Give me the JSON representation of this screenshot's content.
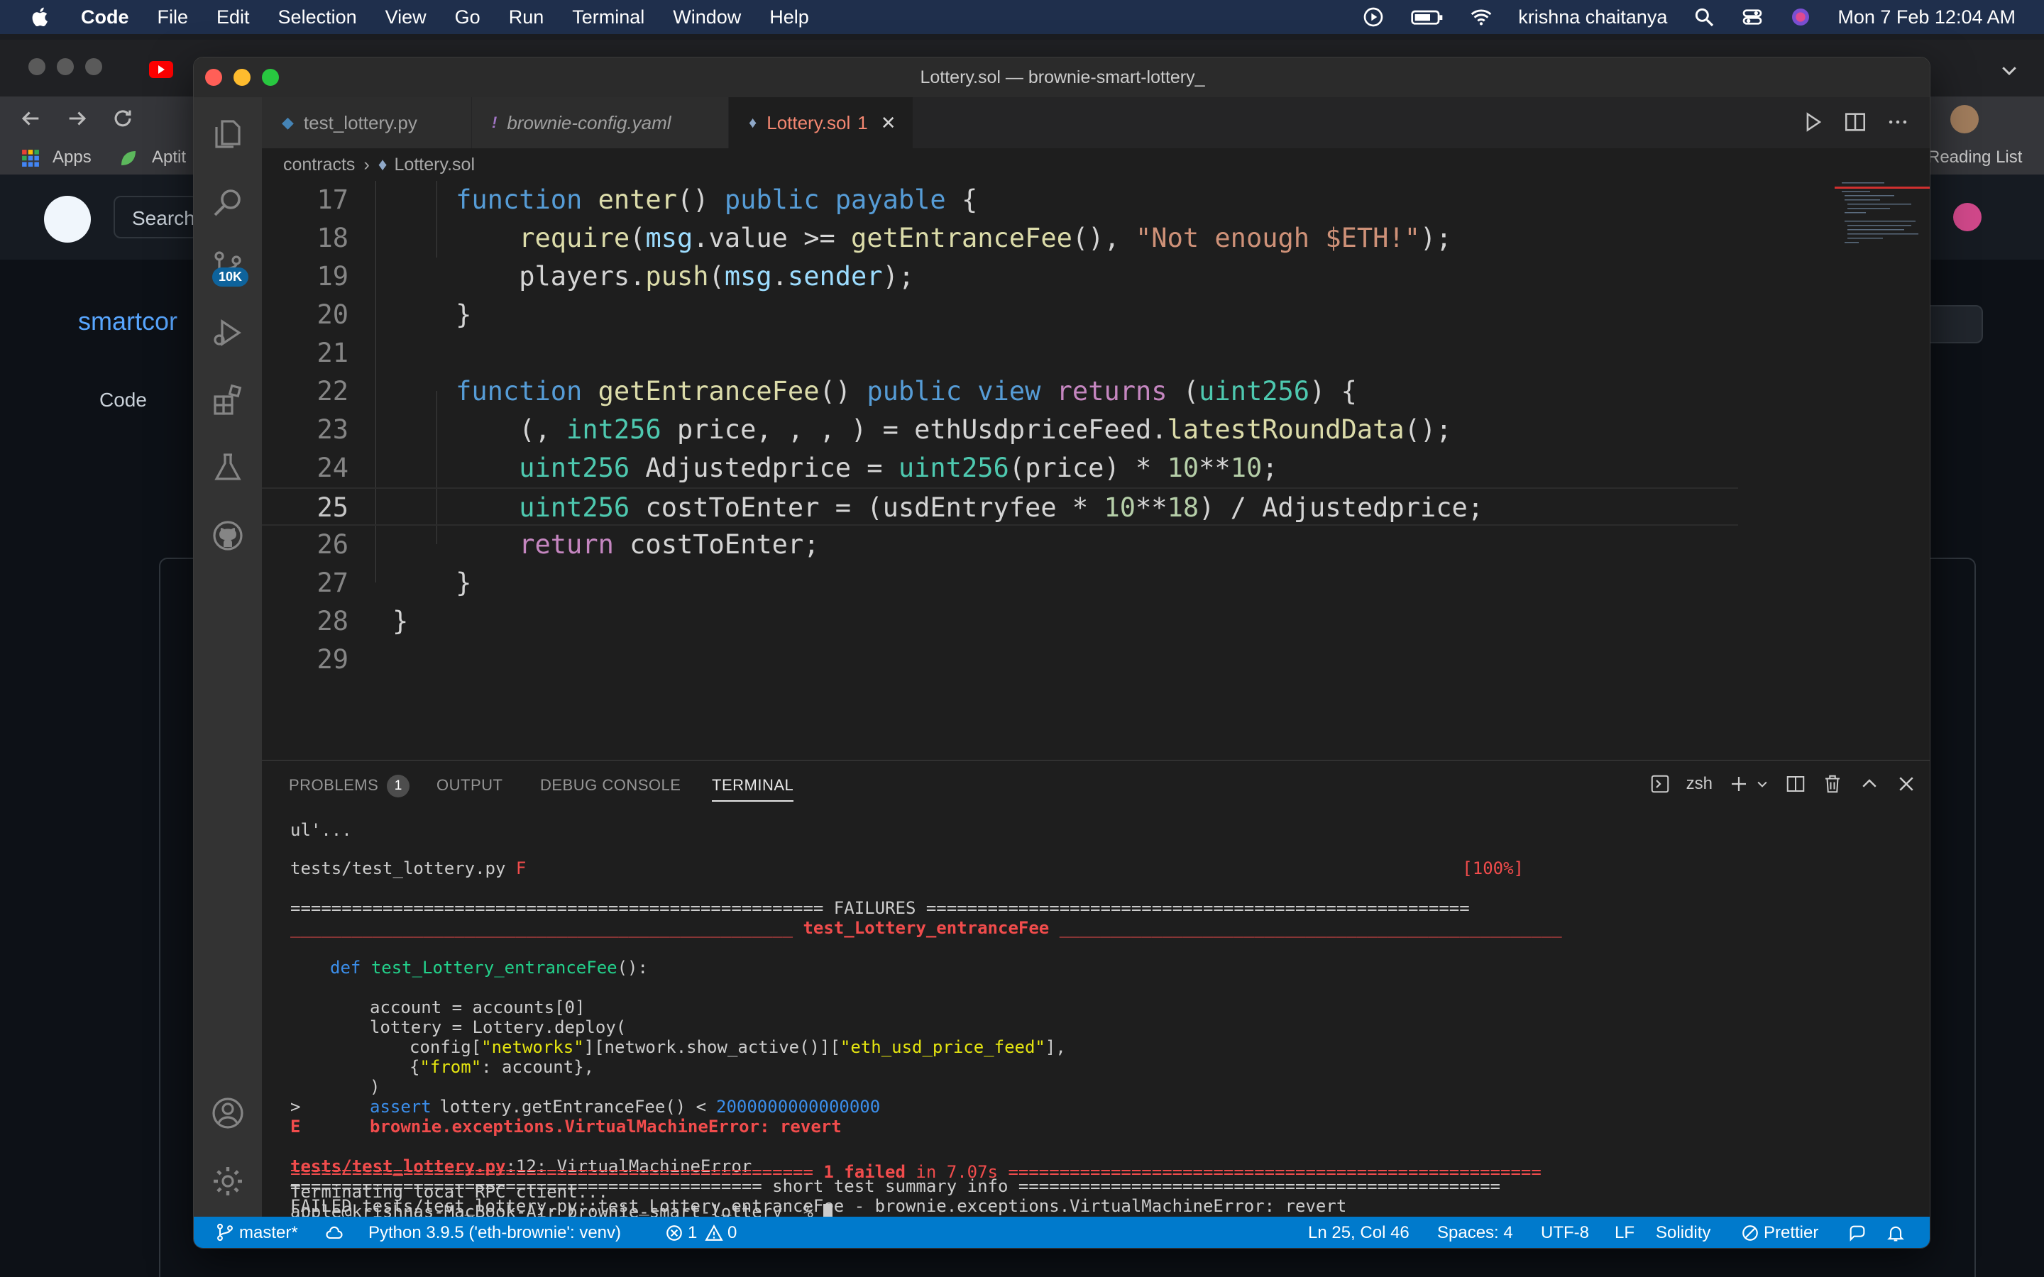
{
  "menubar": {
    "app": "Code",
    "items": [
      "File",
      "Edit",
      "Selection",
      "View",
      "Go",
      "Run",
      "Terminal",
      "Window",
      "Help"
    ],
    "user": "krishna chaitanya",
    "datetime": "Mon 7 Feb  12:04 AM"
  },
  "browser": {
    "bookmarks": [
      "Apps",
      "Aptit"
    ],
    "reading_list": "Reading List",
    "search_label": "Search",
    "repo_name": "smartcor",
    "code_tab": "Code"
  },
  "window": {
    "title": "Lottery.sol — brownie-smart-lottery_"
  },
  "tabs": [
    {
      "label": "test_lottery.py",
      "icon": "python-icon"
    },
    {
      "label": "brownie-config.yaml",
      "icon": "yaml-icon"
    },
    {
      "label": "Lottery.sol",
      "badge": "1",
      "icon": "solidity-icon"
    }
  ],
  "breadcrumb": [
    "contracts",
    "Lottery.sol"
  ],
  "activity": {
    "scm_badge": "10K"
  },
  "editor": {
    "line_numbers": [
      "17",
      "18",
      "19",
      "20",
      "21",
      "22",
      "23",
      "24",
      "25",
      "26",
      "27",
      "28",
      "29"
    ]
  },
  "panel": {
    "tabs": [
      "PROBLEMS",
      "OUTPUT",
      "DEBUG CONSOLE",
      "TERMINAL"
    ],
    "problems_count": "1",
    "shell": "zsh"
  },
  "terminal": {
    "l1": "ul'...",
    "l2a": "tests/test_lottery.py ",
    "l2b": "F",
    "l2c": "[100%]",
    "l3": "==================================================== FAILURES =====================================================",
    "l4a": "_________________________________________________ ",
    "l4b": "test_Lottery_entranceFee",
    "l4c": " _________________________________________________",
    "l5a": "def",
    "l5b": "test_Lottery_entranceFee",
    "l5c": "():",
    "l6": "account = accounts[0]",
    "l7": "lottery = Lottery.deploy(",
    "l8a": "config[",
    "l8b": "\"networks\"",
    "l8c": "][network.show_active()][",
    "l8d": "\"eth_usd_price_feed\"",
    "l8e": "],",
    "l9a": "{",
    "l9b": "\"from\"",
    "l9c": ": account},",
    "l10": ")",
    "l11a": ">",
    "l11b": "assert",
    "l11c": " lottery.getEntranceFee() < ",
    "l11d": "2000000000000000",
    "l12a": "E",
    "l12b": "brownie.exceptions.VirtualMachineError: revert",
    "l13a": "tests/test_lottery.py",
    "l13b": ":12: VirtualMachineError",
    "l14": "============================================== short test summary info ===============================================",
    "l15": "FAILED tests/test_lottery.py::test_Lottery_entranceFee - brownie.exceptions.VirtualMachineError: revert",
    "l16a": "=================================================== ",
    "l16b": "1 failed",
    "l16c": " in 7.07s",
    "l16d": " ====================================================",
    "l17": "Terminating local RPC client...",
    "l18": "apple@krishnas-MacBook-Air brownie-smart-lottery_ % "
  },
  "statusbar": {
    "branch": "master*",
    "python": "Python 3.9.5 ('eth-brownie': venv)",
    "errors": "1",
    "warnings": "0",
    "position": "Ln 25, Col 46",
    "spaces": "Spaces: 4",
    "encoding": "UTF-8",
    "eol": "LF",
    "language": "Solidity",
    "formatter": "Prettier"
  },
  "colors": {
    "status_bar": "#007acc",
    "error_red": "#f14c4c",
    "active_tab_text": "#f48771"
  }
}
